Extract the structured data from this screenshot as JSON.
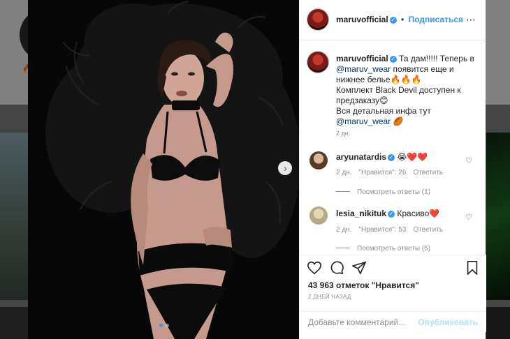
{
  "background": {
    "emoji": "🔥"
  },
  "post": {
    "username": "maruvofficial",
    "follow_label": "Подписаться",
    "separator": "•",
    "caption": {
      "line1": "Та дам!!!!! Теперь в",
      "mention1": "@maruv_wear",
      "line2": " появится еще и нижнее белье🔥🔥🔥",
      "line3": "Комплект Black Devil доступен к предзаказу😊",
      "line4": "Вся детальная инфа тут",
      "mention2": "@maruv_wear",
      "emoji_end": " 🏉"
    },
    "caption_time": "2 дн.",
    "next_icon": "chevron-right-icon"
  },
  "comments": [
    {
      "username": "aryunatardis",
      "text": "😭❤️❤️",
      "time": "2 дн.",
      "likes": "\"Нравится\": 26",
      "reply": "Ответить",
      "view_replies": "Посмотреть ответы (1)"
    },
    {
      "username": "lesia_nikituk",
      "text": "Красиво❤️",
      "time": "2 дн.",
      "likes": "\"Нравится\": 53",
      "reply": "Ответить",
      "view_replies": "Посмотреть ответы (5)"
    }
  ],
  "actions": {
    "likes_text": "43 963 отметок \"Нравится\"",
    "date_text": "2 ДНЕЙ НАЗАД",
    "comment_placeholder": "Добавьте комментарий...",
    "publish_label": "Опубликовать"
  },
  "colors": {
    "accent": "#3897f0",
    "text": "#262626",
    "muted": "#8e8e8e"
  }
}
